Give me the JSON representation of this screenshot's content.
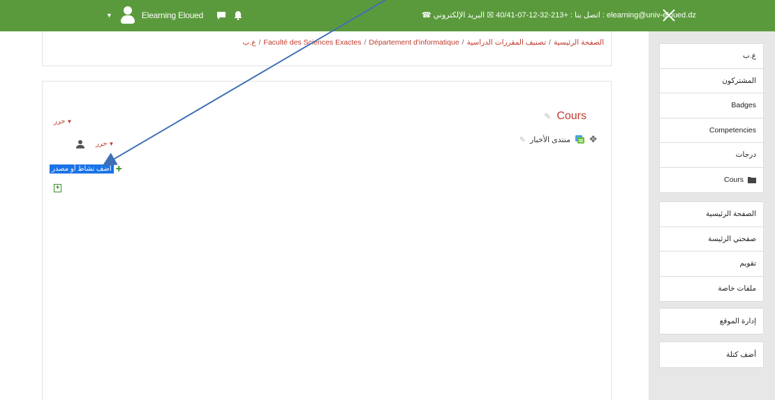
{
  "topbar": {
    "username": "Elearning Eloued",
    "contact": "☎ اتصل بنا : +213-32-12-07-40/41 ☒ البريد الإلكتروني : elearning@univ-eloued.dz",
    "bg_color": "#5a9a3c"
  },
  "breadcrumb": {
    "items": [
      "الصفحة الرئيسية",
      "تصنيف المقررات الدراسية",
      "Faculté des Sciences Exactes",
      "Département d'informatique",
      "ع.ب"
    ],
    "separator": "/"
  },
  "main": {
    "edit_label": "حرر",
    "add_activity_label": "أضف نشاط أو مصدر",
    "section_title": "Cours",
    "forum_label": "منتدى الأخبار"
  },
  "sidebar": {
    "course_nav": [
      "ع.ب",
      "المشتركون",
      "Badges",
      "Competencies",
      "درجات",
      "Cours"
    ],
    "site_nav": [
      "الصفحة الرئيسية",
      "صفحتي الرئيسة",
      "تقويم",
      "ملفات خاصة"
    ],
    "admin": [
      "إدارة الموقع"
    ],
    "add_block": [
      "أضف كتلة"
    ]
  },
  "colors": {
    "link_red": "#c0392b",
    "annotation_arrow": "#3f6fb5",
    "highlight_blue": "#1a73e8"
  }
}
